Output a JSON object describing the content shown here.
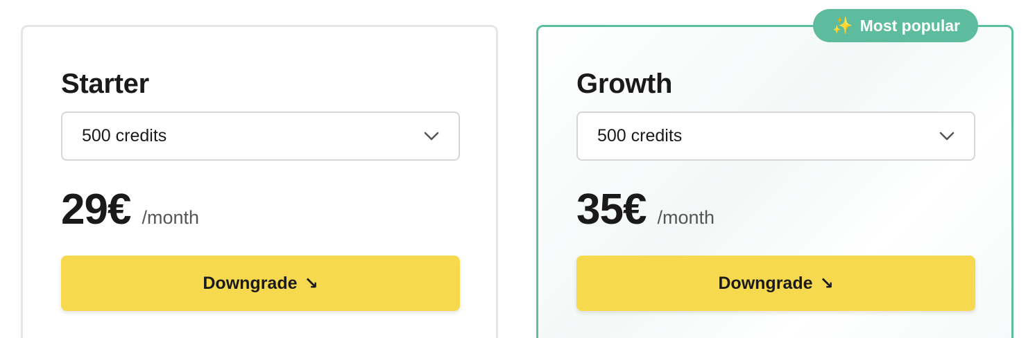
{
  "plans": [
    {
      "name": "Starter",
      "credits": "500 credits",
      "price": "29€",
      "period": "/month",
      "cta_label": "Downgrade",
      "cta_icon": "↘"
    },
    {
      "name": "Growth",
      "badge_label": "Most popular",
      "badge_icon": "✨",
      "credits": "500 credits",
      "price": "35€",
      "period": "/month",
      "cta_label": "Downgrade",
      "cta_icon": "↘"
    }
  ],
  "colors": {
    "accent_green": "#5ebc9e",
    "cta_yellow": "#f6d94e",
    "text": "#1a1a1a",
    "muted": "#555555"
  }
}
